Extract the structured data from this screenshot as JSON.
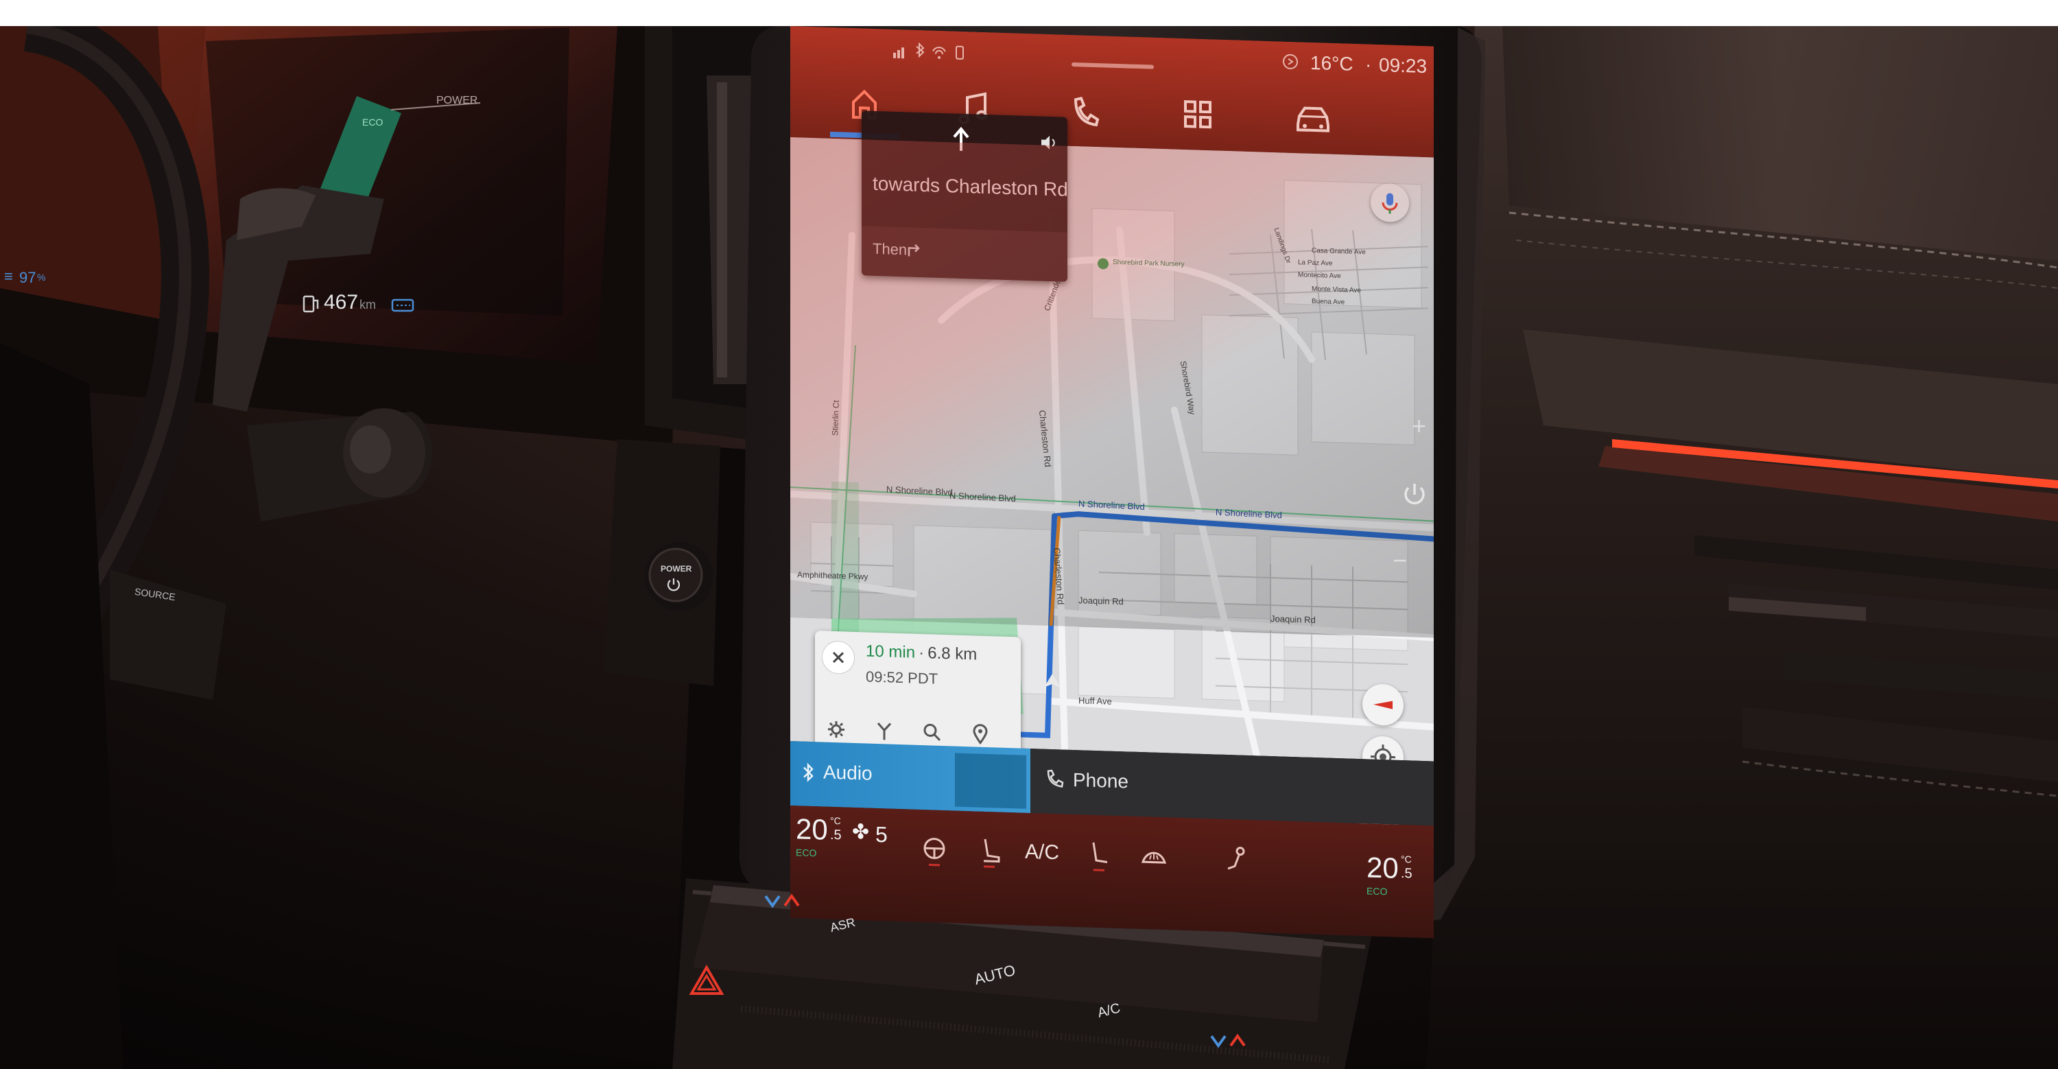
{
  "cluster": {
    "power_label": "POWER",
    "eco_label": "ECO",
    "range_value": "467",
    "range_unit": "km",
    "battery_percent": "97",
    "percent_sign": "%",
    "stalk_source_label": "SOURCE",
    "power_button_label": "POWER"
  },
  "status_bar": {
    "temperature": "16°C",
    "separator": "·",
    "time": "09:23"
  },
  "top_nav": {
    "items": [
      {
        "name": "home",
        "icon": "home-icon",
        "active": true
      },
      {
        "name": "music",
        "icon": "music-note-icon",
        "active": false
      },
      {
        "name": "phone",
        "icon": "phone-icon",
        "active": false
      },
      {
        "name": "apps",
        "icon": "apps-grid-icon",
        "active": false
      },
      {
        "name": "vehicle",
        "icon": "car-icon",
        "active": false
      }
    ]
  },
  "navigation": {
    "instruction": "towards Charleston Rd",
    "then_label": "Then",
    "eta_minutes": "10 min",
    "eta_separator": "·",
    "distance": "6.8 km",
    "arrival_time": "09:52 PDT",
    "zoom_in": "+",
    "zoom_out": "−"
  },
  "map": {
    "street_labels": [
      "N Shoreline Blvd",
      "N Shoreline Blvd",
      "N Shoreline Blvd",
      "N Shoreline Blvd",
      "Charleston Rd",
      "Charleston Rd",
      "Joaquin Rd",
      "Joaquin Rd",
      "Huff Ave",
      "Amphitheatre Pkwy",
      "Shorebird Way",
      "Stierlin Ct",
      "Crittenden Ln",
      "Casa Grande Ave",
      "La Paz Ave",
      "Montecito Ave",
      "Monte Vista Ave",
      "Buena Ave",
      "Shorebird Park Nursery",
      "Landings Dr"
    ]
  },
  "media_cards": {
    "audio_label": "Audio",
    "phone_label": "Phone"
  },
  "climate_bar": {
    "left_temp": "20",
    "left_decimal": ".5",
    "temp_unit": "°C",
    "right_temp": "20",
    "right_decimal": ".5",
    "eco_label": "ECO",
    "fan_speed": "5",
    "ac_label": "A/C"
  },
  "hard_buttons": {
    "auto_label": "AUTO",
    "ac_label": "A/C",
    "asr_label": "ASR",
    "plus": "+",
    "minus": "−"
  },
  "colors": {
    "accent_red": "#c8302a",
    "map_route_blue": "#2f6fd0",
    "ambient_light": "#ff4a2a",
    "eco_green": "#3fbf7f"
  }
}
